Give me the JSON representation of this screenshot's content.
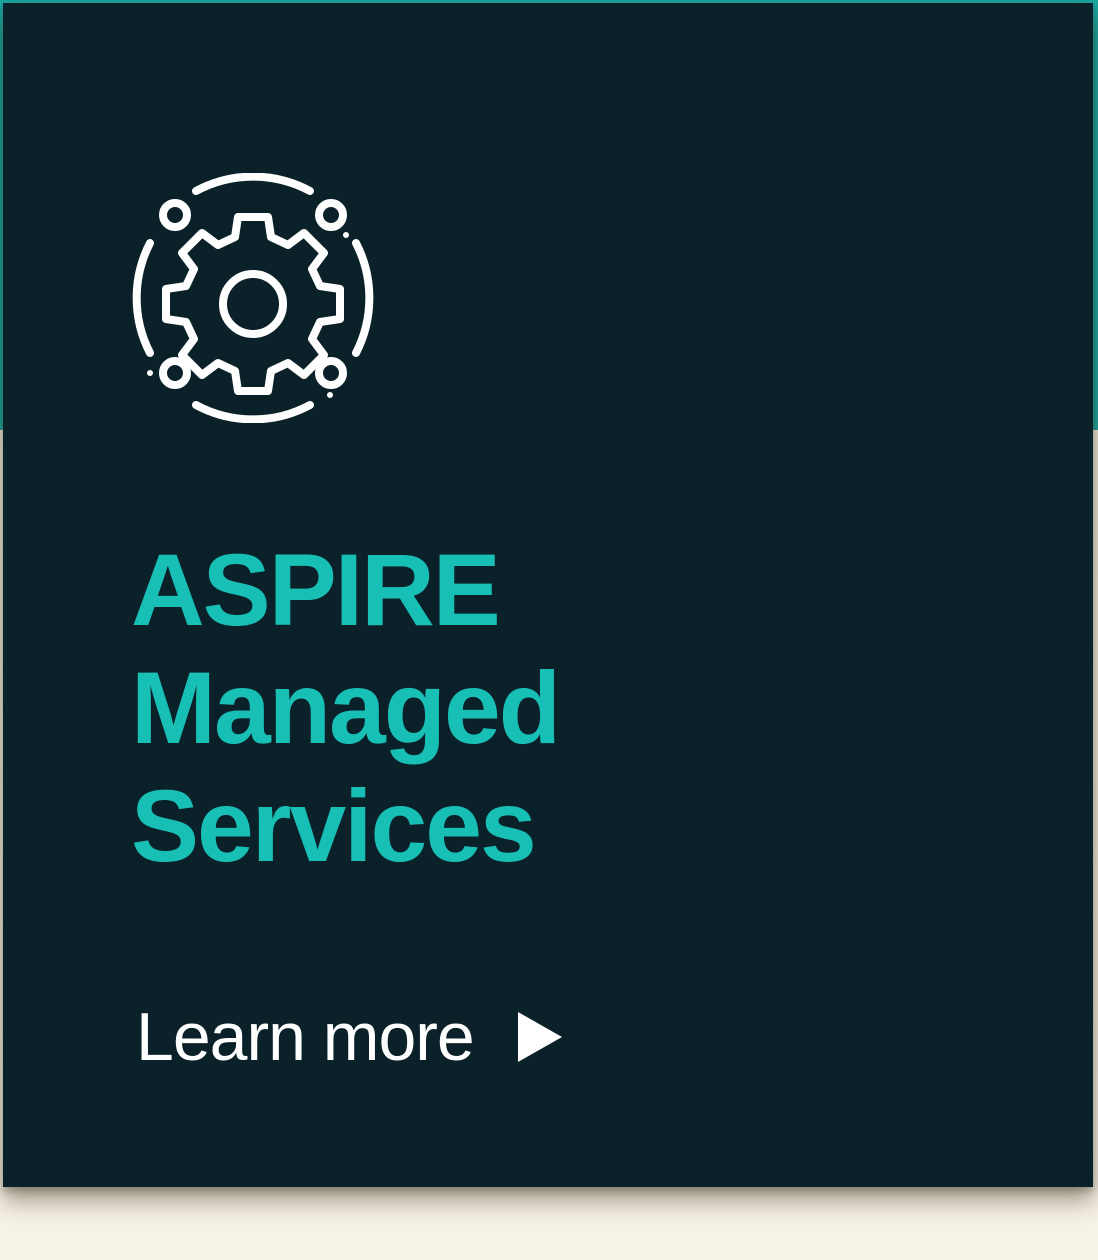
{
  "card": {
    "icon": "gear-network-icon",
    "title_lines": [
      "ASPIRE",
      "Managed",
      "Services"
    ],
    "cta_label": "Learn more",
    "cta_icon": "play-arrow-icon"
  },
  "colors": {
    "card_background": "#0b212a",
    "title_accent": "#18bfb5",
    "border_accent": "#1aa7a0",
    "page_background": "#f6f1e6",
    "text_light": "#ffffff"
  }
}
